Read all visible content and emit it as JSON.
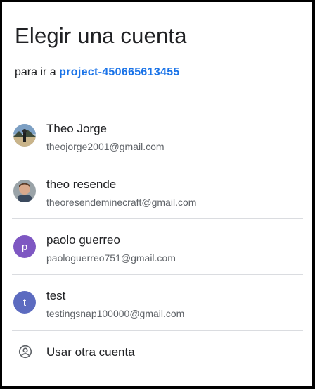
{
  "header": {
    "title": "Elegir una cuenta",
    "subtitle_prefix": "para ir a",
    "project_link": "project-450665613455"
  },
  "accounts": [
    {
      "name": "Theo Jorge",
      "email": "theojorge2001@gmail.com",
      "avatar": "photo-landscape"
    },
    {
      "name": "theo resende",
      "email": "theoresendeminecraft@gmail.com",
      "avatar": "photo-person"
    },
    {
      "name": "paolo guerreo",
      "email": "paologuerreo751@gmail.com",
      "avatar_letter": "p",
      "avatar_color": "#7e57c2"
    },
    {
      "name": "test",
      "email": "testingsnap100000@gmail.com",
      "avatar_letter": "t",
      "avatar_color": "#5c6bc0"
    }
  ],
  "other_account": {
    "label": "Usar otra cuenta",
    "icon": "account-circle-icon"
  },
  "colors": {
    "link": "#1a73e8",
    "divider": "#dadce0",
    "text": "#202124",
    "secondary": "#5f6368"
  }
}
